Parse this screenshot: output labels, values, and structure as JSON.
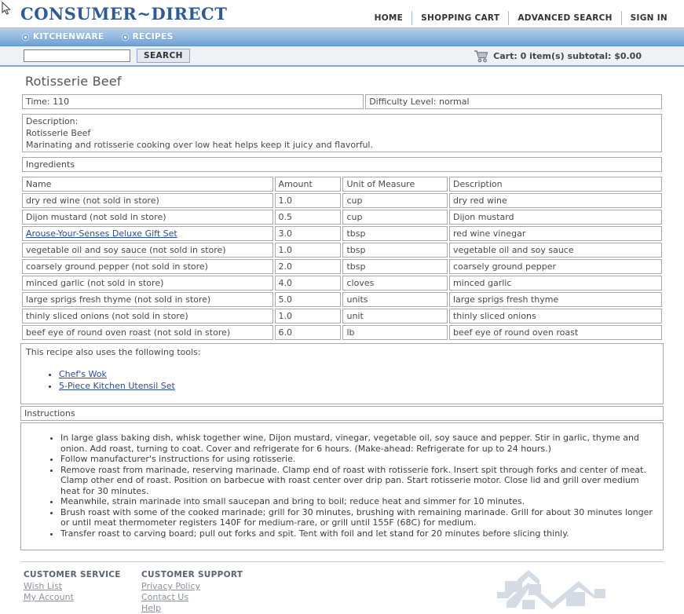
{
  "site": {
    "logo": "CONSUMER~DIRECT"
  },
  "topnav": [
    {
      "label": "HOME",
      "name": "home"
    },
    {
      "label": "SHOPPING CART",
      "name": "shopping-cart"
    },
    {
      "label": "ADVANCED SEARCH",
      "name": "advanced-search"
    },
    {
      "label": "SIGN IN",
      "name": "sign-in"
    }
  ],
  "navbar": [
    {
      "label": "KITCHENWARE",
      "name": "kitchenware"
    },
    {
      "label": "RECIPES",
      "name": "recipes"
    }
  ],
  "search": {
    "value": "",
    "placeholder": "",
    "button_label": "SEARCH"
  },
  "cart": {
    "icon": "shopping-cart-icon",
    "text": "Cart: 0 item(s) subtotal: $0.00"
  },
  "recipe": {
    "title": "Rotisserie Beef",
    "time": "Time: 110",
    "difficulty": "Difficulty Level: normal",
    "description": "Description:\nRotisserie Beef\nMarinating and rotisserie cooking over low heat helps keep it juicy and flavorful.",
    "ingredients_header": "Ingredients",
    "instructions_header": "Instructions",
    "tools_intro": "This recipe also uses the following tools:"
  },
  "ingredients": {
    "columns": [
      "Name",
      "Amount",
      "Unit of Measure",
      "Description"
    ],
    "rows": [
      {
        "name": "dry red wine (not sold in store)",
        "link": false,
        "amount": "1.0",
        "unit": "cup",
        "description": "dry red wine"
      },
      {
        "name": "Dijon mustard (not sold in store)",
        "link": false,
        "amount": "0.5",
        "unit": "cup",
        "description": "Dijon mustard"
      },
      {
        "name": "Arouse-Your-Senses Deluxe Gift Set",
        "link": true,
        "amount": "3.0",
        "unit": "tbsp",
        "description": "red wine vinegar"
      },
      {
        "name": "vegetable oil and soy sauce (not sold in store)",
        "link": false,
        "amount": "1.0",
        "unit": "tbsp",
        "description": "vegetable oil and soy sauce"
      },
      {
        "name": "coarsely ground pepper (not sold in store)",
        "link": false,
        "amount": "2.0",
        "unit": "tbsp",
        "description": "coarsely ground pepper"
      },
      {
        "name": "minced garlic (not sold in store)",
        "link": false,
        "amount": "4.0",
        "unit": "cloves",
        "description": "minced garlic"
      },
      {
        "name": "large sprigs fresh thyme (not sold in store)",
        "link": false,
        "amount": "5.0",
        "unit": "units",
        "description": "large sprigs fresh thyme"
      },
      {
        "name": "thinly sliced onions (not sold in store)",
        "link": false,
        "amount": "1.0",
        "unit": "unit",
        "description": "thinly sliced onions"
      },
      {
        "name": "beef eye of round oven roast (not sold in store)",
        "link": false,
        "amount": "6.0",
        "unit": "lb",
        "description": "beef eye of round oven roast"
      }
    ]
  },
  "tools": [
    "Chef's Wok",
    "5-Piece Kitchen Utensil Set"
  ],
  "instructions": [
    "In large glass baking dish, whisk together wine, Dijon mustard, vinegar, vegetable oil, soy sauce and pepper. Stir in garlic, thyme and onion. Add roast, turning to coat. Cover and refrigerate for 6 hours. (Make-ahead: Refrigerate for up to 24 hours.)",
    "Follow manufacturer's instructions for using rotisserie.",
    "Remove roast from marinade, reserving marinade. Clamp end of roast with rotisserie fork. Insert spit through forks and center of meat. Clamp other end of roast. Position on barbecue with roast center over drip pan. Start rotisserie motor. Close lid and grill over medium heat for 30 minutes.",
    "Meanwhile, strain marinade into small saucepan and bring to boil; reduce heat and simmer for 10 minutes.",
    "Brush roast with some of the cooked marinade; grill for 30 minutes, brushing with remaining marinade. Grill for about 30 minutes longer or until meat thermometer registers 140F for medium-rare, or grill until 155F (68C) for medium.",
    "Transfer roast to carving board; pull out forks and spit. Tent with foil and let stand for 20 minutes before slicing thinly."
  ],
  "footer": {
    "columns": [
      {
        "heading": "CUSTOMER SERVICE",
        "links": [
          "Wish List",
          "My Account"
        ]
      },
      {
        "heading": "CUSTOMER SUPPORT",
        "links": [
          "Privacy Policy",
          "Contact Us",
          "Help"
        ]
      }
    ],
    "artwork": "rooftops-watermark"
  },
  "colors": {
    "brand_blue": "#2f5a93",
    "nav_blue": "#8bb5de",
    "link_blue": "#2b4b94",
    "searchbar_bg": "#eef1f6",
    "border_grey": "#a9a9a9",
    "footer_art": "#d5dee6"
  }
}
